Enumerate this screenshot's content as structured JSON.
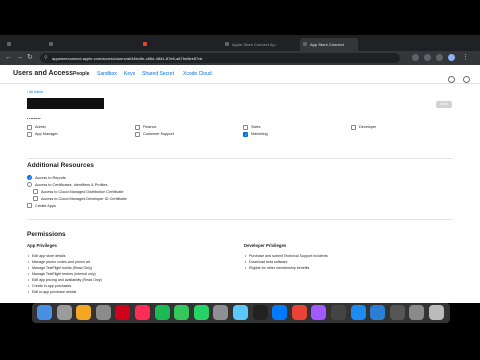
{
  "browser": {
    "tabs": [
      {
        "title": ""
      },
      {
        "title": ""
      },
      {
        "title": ""
      },
      {
        "title": "Apple Store Connect Ap..."
      },
      {
        "title": "App Store Connect",
        "active": true
      }
    ],
    "url": "appstoreconnect.apple.com/access/users/ab34bc5e-c86d-48d1-87e6-a87be8ee87dc"
  },
  "header": {
    "title": "Users and Access",
    "nav": [
      "People",
      "Sandbox",
      "Keys",
      "Shared Secret",
      "Xcode Cloud"
    ]
  },
  "breadcrumb": "All Users",
  "save_label": "Save",
  "roles": {
    "heading": "Roles",
    "items": [
      {
        "label": "Admin",
        "checked": false
      },
      {
        "label": "Finance",
        "checked": false
      },
      {
        "label": "Sales",
        "checked": false
      },
      {
        "label": "Developer",
        "checked": false
      },
      {
        "label": "App Manager",
        "checked": false
      },
      {
        "label": "Customer Support",
        "checked": false
      },
      {
        "label": "Marketing",
        "checked": true
      }
    ]
  },
  "additional_resources": {
    "heading": "Additional Resources",
    "items": [
      {
        "label": "Access to Reports",
        "checked": true
      },
      {
        "label": "Access to Certificates, Identifiers & Profiles.",
        "checked": false
      },
      {
        "label": "Access to Cloud Managed Distribution Certificate",
        "checked": false
      },
      {
        "label": "Access to Cloud Managed Developer ID Certificate",
        "checked": false
      },
      {
        "label": "Create Apps",
        "checked": false
      }
    ]
  },
  "permissions": {
    "heading": "Permissions",
    "app_privileges": {
      "heading": "App Privileges",
      "items": [
        "Edit app store details",
        "Manage promo codes and promo art",
        "Manage TestFlight builds (Read Only)",
        "Manage TestFlight testers (internal only)",
        "Edit app pricing and availability (Read Only)",
        "Create in-app purchases",
        "Edit in-app purchase details"
      ]
    },
    "developer_privileges": {
      "heading": "Developer Privileges",
      "items": [
        "Purchase and submit Technical Support Incidents",
        "Download beta software",
        "Eligible for other membership benefits"
      ]
    }
  },
  "dock": {
    "icons": [
      "finder-icon",
      "launchpad-icon",
      "calculator-icon",
      "files-icon",
      "app-icon",
      "music-icon",
      "spotify-icon",
      "messages-icon",
      "whatsapp-icon",
      "settings-icon",
      "app-icon",
      "terminal-icon",
      "app-icon",
      "chrome-icon",
      "figma-icon",
      "app-icon",
      "xcode-icon",
      "vscode-icon",
      "app-icon",
      "app-icon",
      "trash-icon"
    ],
    "colors": [
      "#4a90e2",
      "#9b9b9b",
      "#f5a623",
      "#8b8b8b",
      "#d0021b",
      "#ff2d55",
      "#1db954",
      "#34c759",
      "#25d366",
      "#8e8e93",
      "#5ac8fa",
      "#222222",
      "#007aff",
      "#ea4335",
      "#a259ff",
      "#444444",
      "#1c8cf0",
      "#2a7fd4",
      "#555555",
      "#8a8a8a",
      "#bbbbbb"
    ]
  },
  "colors": {
    "accent": "#0071e3",
    "text": "#1d1d1f"
  }
}
